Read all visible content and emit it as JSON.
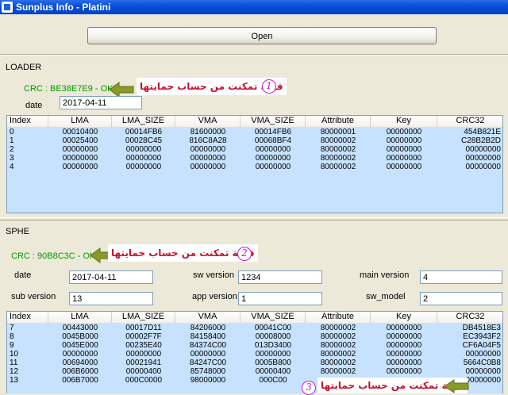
{
  "window": {
    "title": "Sunplus  Info - Platini"
  },
  "toolbar": {
    "open_label": "Open"
  },
  "loader": {
    "group_label": "LOADER",
    "crc_text": "CRC : BE38E7E9 - OK!",
    "annotation_number": "1",
    "annotation_text": "قيمة تمكنت من حساب حمايتها",
    "date_label": "date",
    "date_value": "2017-04-11",
    "table": {
      "columns": [
        "Index",
        "LMA",
        "LMA_SIZE",
        "VMA",
        "VMA_SIZE",
        "Attribute",
        "Key",
        "CRC32"
      ],
      "rows": [
        [
          "0",
          "00010400",
          "00014FB6",
          "81600000",
          "00014FB6",
          "80000001",
          "00000000",
          "454B821E"
        ],
        [
          "1",
          "00025400",
          "00028C45",
          "816C8A28",
          "00068BF4",
          "80000002",
          "00000000",
          "C28B2B2D"
        ],
        [
          "2",
          "00000000",
          "00000000",
          "00000000",
          "00000000",
          "80000002",
          "00000000",
          "00000000"
        ],
        [
          "3",
          "00000000",
          "00000000",
          "00000000",
          "00000000",
          "80000002",
          "00000000",
          "00000000"
        ],
        [
          "4",
          "00000000",
          "00000000",
          "00000000",
          "00000000",
          "80000002",
          "00000000",
          "00000000"
        ]
      ]
    }
  },
  "sphe": {
    "group_label": "SPHE",
    "crc_text": "CRC :  90B8C3C - OK!",
    "annotation_number": "2",
    "annotation_text": "قيمة تمكنت من حساب حمايتها",
    "fields": {
      "date_label": "date",
      "date_value": "2017-04-11",
      "sw_version_label": "sw version",
      "sw_version_value": "1234",
      "main_version_label": "main version",
      "main_version_value": "4",
      "sub_version_label": "sub version",
      "sub_version_value": "13",
      "app_version_label": "app version",
      "app_version_value": "1",
      "sw_model_label": "sw_model",
      "sw_model_value": "2"
    },
    "table": {
      "columns": [
        "Index",
        "LMA",
        "LMA_SIZE",
        "VMA",
        "VMA_SIZE",
        "Attribute",
        "Key",
        "CRC32"
      ],
      "rows": [
        [
          "7",
          "00443000",
          "00017D11",
          "84206000",
          "00041C00",
          "80000002",
          "00000000",
          "DB4518E3"
        ],
        [
          "8",
          "0045B000",
          "00002F7F",
          "84158400",
          "00008000",
          "80000002",
          "00000000",
          "EC3943F2"
        ],
        [
          "9",
          "0045E000",
          "00235E40",
          "84374C00",
          "013D3400",
          "80000002",
          "00000000",
          "CF6A04F5"
        ],
        [
          "10",
          "00000000",
          "00000000",
          "00000000",
          "00000000",
          "80000002",
          "00000000",
          "00000000"
        ],
        [
          "11",
          "00694000",
          "00021941",
          "84247C00",
          "0005B800",
          "80000002",
          "00000000",
          "5664C0B8"
        ],
        [
          "12",
          "006B6000",
          "00000400",
          "85748000",
          "00000400",
          "80000002",
          "00000000",
          "00000000"
        ],
        [
          "13",
          "006B7000",
          "000C0000",
          "98000000",
          "000C00",
          "",
          "",
          "00000000"
        ]
      ]
    },
    "annotation3_number": "3",
    "annotation3_text": "قيمة تمكنت من حساب حمايتها"
  },
  "colors": {
    "accent_title": "#0a4fd8",
    "crc_ok": "#009a00",
    "annotation": "#c8102e",
    "badge": "#c020d0",
    "list_bg": "#c6e2ff"
  }
}
